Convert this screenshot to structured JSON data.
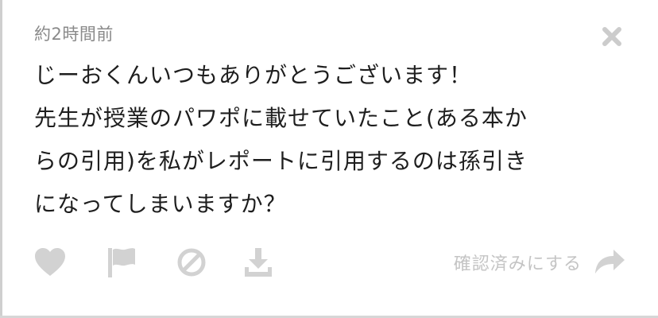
{
  "post": {
    "timestamp": "約2時間前",
    "message_lines": [
      "じーおくんいつもありがとうございます！",
      "先生が授業のパワポに載せていたこと(ある本か",
      "らの引用)を私がレポートに引用するのは孫引き",
      "になってしまいますか？"
    ]
  },
  "actions": {
    "like_icon": "heart-icon",
    "report_icon": "flag-icon",
    "block_icon": "prohibit-icon",
    "download_icon": "download-icon",
    "confirm_label": "確認済みにする",
    "confirm_icon": "share-arrow-icon",
    "close_icon": "close-icon"
  },
  "colors": {
    "icon_gray": "#d0d0d0",
    "timestamp_gray": "#8a8a8a",
    "text": "#1e1e1e"
  }
}
